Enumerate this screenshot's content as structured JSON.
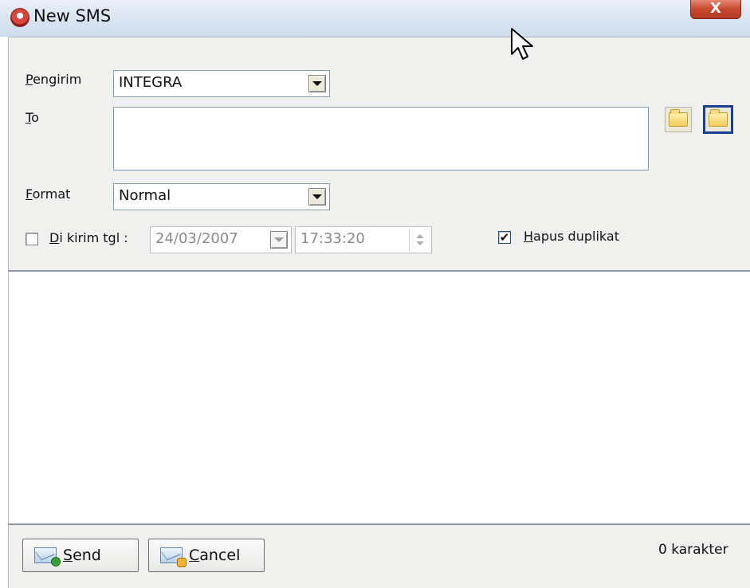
{
  "window": {
    "title": "New SMS",
    "close_label": "X"
  },
  "pengirim": {
    "label_first": "P",
    "label_rest": "engirim",
    "value": "INTEGRA"
  },
  "to": {
    "label_first": "T",
    "label_rest": "o",
    "value": ""
  },
  "format": {
    "label_first": "F",
    "label_rest": "ormat",
    "value": "Normal"
  },
  "schedule": {
    "label_first": "D",
    "label_rest": "i kirim tgl :",
    "checked": false,
    "date": "24/03/2007",
    "time": "17:33:20"
  },
  "hapus": {
    "label_first": "H",
    "label_rest": "apus duplikat",
    "checked": true,
    "mark": "✔"
  },
  "message": {
    "value": ""
  },
  "footer": {
    "send_first": "S",
    "send_rest": "end",
    "cancel_first": "C",
    "cancel_rest": "ancel",
    "char_count": "0 karakter"
  },
  "icons": {
    "app": "sms-app-icon",
    "folder": "folder-icon",
    "send": "envelope-send-icon",
    "cancel": "envelope-cancel-icon"
  }
}
